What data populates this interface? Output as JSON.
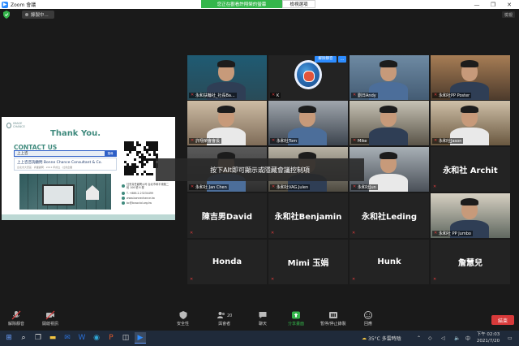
{
  "window": {
    "app_title": "Zoom 會議",
    "share_banner": "您正在觀看許翔榮的螢幕",
    "view_options": "檢視選項",
    "minimize": "—",
    "maximize": "❐",
    "close": "✕"
  },
  "meeting": {
    "recording_chip": "錄製中...",
    "view_button": "檢視"
  },
  "shared_screen": {
    "logo_text": "IMAGE CHANCE",
    "thank_you": "Thank You.",
    "contact_us": "CONTACT US",
    "search_value": "上上咨",
    "search_button": "搜尋",
    "result_title": "上上咨咨詢顧問 Bonne Chance Consultant & Co.",
    "result_sub": "台北市大安區 · 商業顧問 · 2011 年成立 · 社會企業",
    "info_address": "社會責任顧問公司 台北市和平東路二段 106 號 6 樓",
    "info_phone": "T. +886-2-23234499",
    "info_web": "www.bonnechance.tw",
    "info_email": "bc@bcsocial.org.tw"
  },
  "tiles": [
    {
      "label": "永和扶輪社_社長Ba...",
      "kind": "video",
      "muted": true
    },
    {
      "label": "K",
      "kind": "logo",
      "muted": true
    },
    {
      "label": "劉日Andy",
      "kind": "video",
      "muted": true
    },
    {
      "label": "永和社PP Poster",
      "kind": "video",
      "muted": true
    },
    {
      "label": "許翔榮會會長",
      "kind": "video",
      "muted": true,
      "active": true
    },
    {
      "label": "永和社Tom",
      "kind": "video",
      "muted": true
    },
    {
      "label": "Mike",
      "kind": "video",
      "muted": true
    },
    {
      "label": "永和社Jason",
      "kind": "video",
      "muted": true
    },
    {
      "label": "永和社 Jan Chen",
      "kind": "video",
      "muted": true
    },
    {
      "label": "永和社VAG.Julen",
      "kind": "video",
      "muted": true
    },
    {
      "label": "永和社Jun",
      "kind": "video",
      "muted": true
    },
    {
      "label": "永和社 Archit",
      "kind": "name",
      "muted": true
    },
    {
      "label": "陳吉男David",
      "kind": "name",
      "muted": true
    },
    {
      "label": "永和社Benjamin",
      "kind": "name",
      "muted": true
    },
    {
      "label": "永和社Leding",
      "kind": "name",
      "muted": true
    },
    {
      "label": "永和社 PP Jumbo",
      "kind": "video",
      "muted": true
    },
    {
      "label": "Honda",
      "kind": "name",
      "muted": true
    },
    {
      "label": "Mimi 玉娟",
      "kind": "name",
      "muted": true
    },
    {
      "label": "Hunk",
      "kind": "name",
      "muted": true
    },
    {
      "label": "詹慧兒",
      "kind": "name",
      "muted": true
    }
  ],
  "overlay_message": "按下Alt即可顯示或隱藏會議控制項",
  "toolbar": {
    "unmute": "解除靜音",
    "start_video": "開啟視訊",
    "security": "安全性",
    "participants": "與會者",
    "participants_count": "20",
    "chat": "聊天",
    "share_screen": "分享畫面",
    "record": "暫停/停止錄製",
    "reactions": "回應",
    "end": "結束"
  },
  "taskbar": {
    "weather": "35°C 多雲時陰",
    "time": "下午 02:03",
    "date": "2021/7/20",
    "ime": "中"
  },
  "colors": {
    "zoom_blue": "#2d8cff",
    "share_green": "#34b64b",
    "end_red": "#d83a3a",
    "muted_red": "#e13c3c",
    "active_speaker": "#c6e86a"
  }
}
